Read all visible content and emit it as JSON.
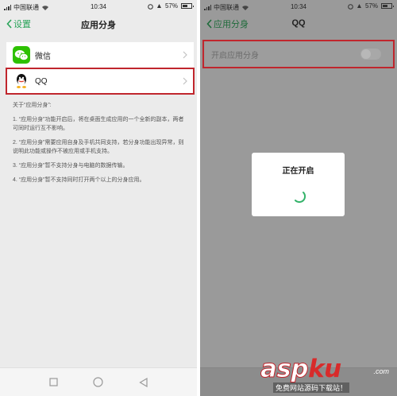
{
  "status_bar": {
    "carrier": "中国联通",
    "time": "10:34",
    "battery": "57%"
  },
  "left": {
    "back_label": "设置",
    "title": "应用分身",
    "apps": [
      {
        "label": "微信",
        "icon": "wechat-icon"
      },
      {
        "label": "QQ",
        "icon": "qq-icon"
      }
    ],
    "about_title": "关于“应用分身”:",
    "about_items": [
      "1. “应用分身”功能开启后，将在桌面生成应用的一个全新的副本，两者可同时运行互不影响。",
      "2. “应用分身”需要应用自身及手机共同支持，若分身功能出现异常，则说明此功能或操作不被应用或手机支持。",
      "3. “应用分身”暂不支持分身与电脑的数据传输。",
      "4. “应用分身”暂不支持同时打开两个以上的分身应用。"
    ]
  },
  "right": {
    "back_label": "应用分身",
    "title": "QQ",
    "toggle_label": "开启应用分身",
    "toggle_on": false,
    "dialog_text": "正在开启"
  },
  "colors": {
    "accent": "#2aa45a",
    "highlight": "#c0262d",
    "wechat": "#2dc100",
    "overlay": "#9a9a9a"
  },
  "watermark": {
    "brand_a": "asp",
    "brand_b": "ku",
    "tld": ".com",
    "subtitle": "免费网站源码下载站！"
  }
}
